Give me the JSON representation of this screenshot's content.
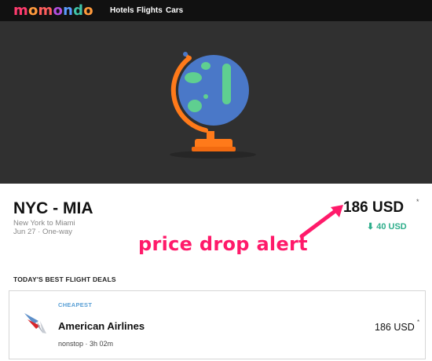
{
  "brand": {
    "logo_letters": [
      "m",
      "o",
      "m",
      "o",
      "n",
      "d",
      "o"
    ],
    "logo_colors": [
      "#ff3c6e",
      "#ff9a3c",
      "#ff5e5e",
      "#b34fe0",
      "#5a9cff",
      "#40c4a8",
      "#ff9a3c"
    ]
  },
  "nav": {
    "hotels": "Hotels",
    "flights": "Flights",
    "cars": "Cars"
  },
  "trip": {
    "route": "NYC - MIA",
    "cities": "New York to Miami",
    "date_type": "Jun 27 · One-way",
    "price": "186 USD",
    "price_note": "*",
    "drop_arrow": "⬇",
    "drop": "40 USD"
  },
  "annotation": {
    "text": "price drop alert",
    "color": "#ff1a6a"
  },
  "deals": {
    "section_title": "TODAY'S BEST FLIGHT DEALS",
    "items": [
      {
        "badge": "CHEAPEST",
        "airline": "American Airlines",
        "details": "nonstop · 3h 02m",
        "price": "186 USD",
        "price_note": "*",
        "logo_icon": "american-airlines-logo-icon"
      }
    ]
  },
  "colors": {
    "topbar": "#111111",
    "hero_bg": "#303030",
    "globe_ocean": "#4a78c8",
    "globe_land": "#5fcf90",
    "stand": "#ff7a1a",
    "drop_green": "#2eae8b",
    "badge_blue": "#5aa0d6"
  }
}
